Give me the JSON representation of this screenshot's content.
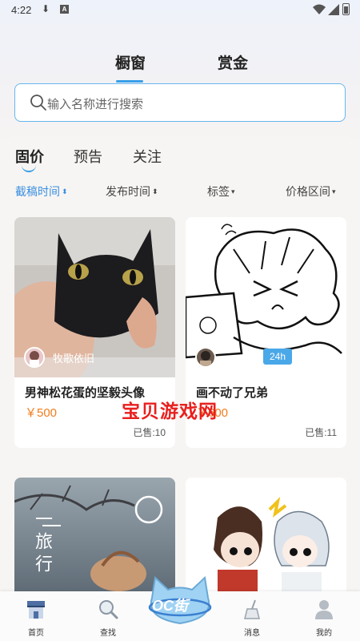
{
  "status_bar": {
    "time": "4:22"
  },
  "top_tabs": [
    {
      "label": "橱窗",
      "active": true
    },
    {
      "label": "赏金",
      "active": false
    }
  ],
  "search": {
    "placeholder": "输入名称进行搜索"
  },
  "sub_tabs": [
    {
      "label": "固价",
      "active": true
    },
    {
      "label": "预告",
      "active": false
    },
    {
      "label": "关注",
      "active": false
    }
  ],
  "filters": [
    {
      "label": "截稿时间",
      "active": true
    },
    {
      "label": "发布时间",
      "active": false
    },
    {
      "label": "标签",
      "active": false
    },
    {
      "label": "价格区间",
      "active": false
    }
  ],
  "cards": [
    {
      "author": "牧歌依旧",
      "title": "男神松花蛋的坚毅头像",
      "price": "￥500",
      "sold": "已售:10"
    },
    {
      "author": "",
      "badge": "24h",
      "title": "画不动了兄弟",
      "price": "￥600",
      "sold": "已售:11"
    },
    {
      "art_text": "一 旅 行"
    },
    {}
  ],
  "watermark": "宝贝游戏网",
  "bottom_nav": [
    {
      "label": "首页",
      "icon": "shop-icon",
      "active": true
    },
    {
      "label": "查找",
      "icon": "magnifier-icon"
    },
    {
      "label": "OC街",
      "icon": "oc-cat-icon"
    },
    {
      "label": "消息",
      "icon": "broom-icon"
    },
    {
      "label": "我的",
      "icon": "user-icon"
    }
  ],
  "colors": {
    "accent": "#3a9ee8",
    "price": "#f07d1d",
    "watermark": "#e8201e"
  }
}
